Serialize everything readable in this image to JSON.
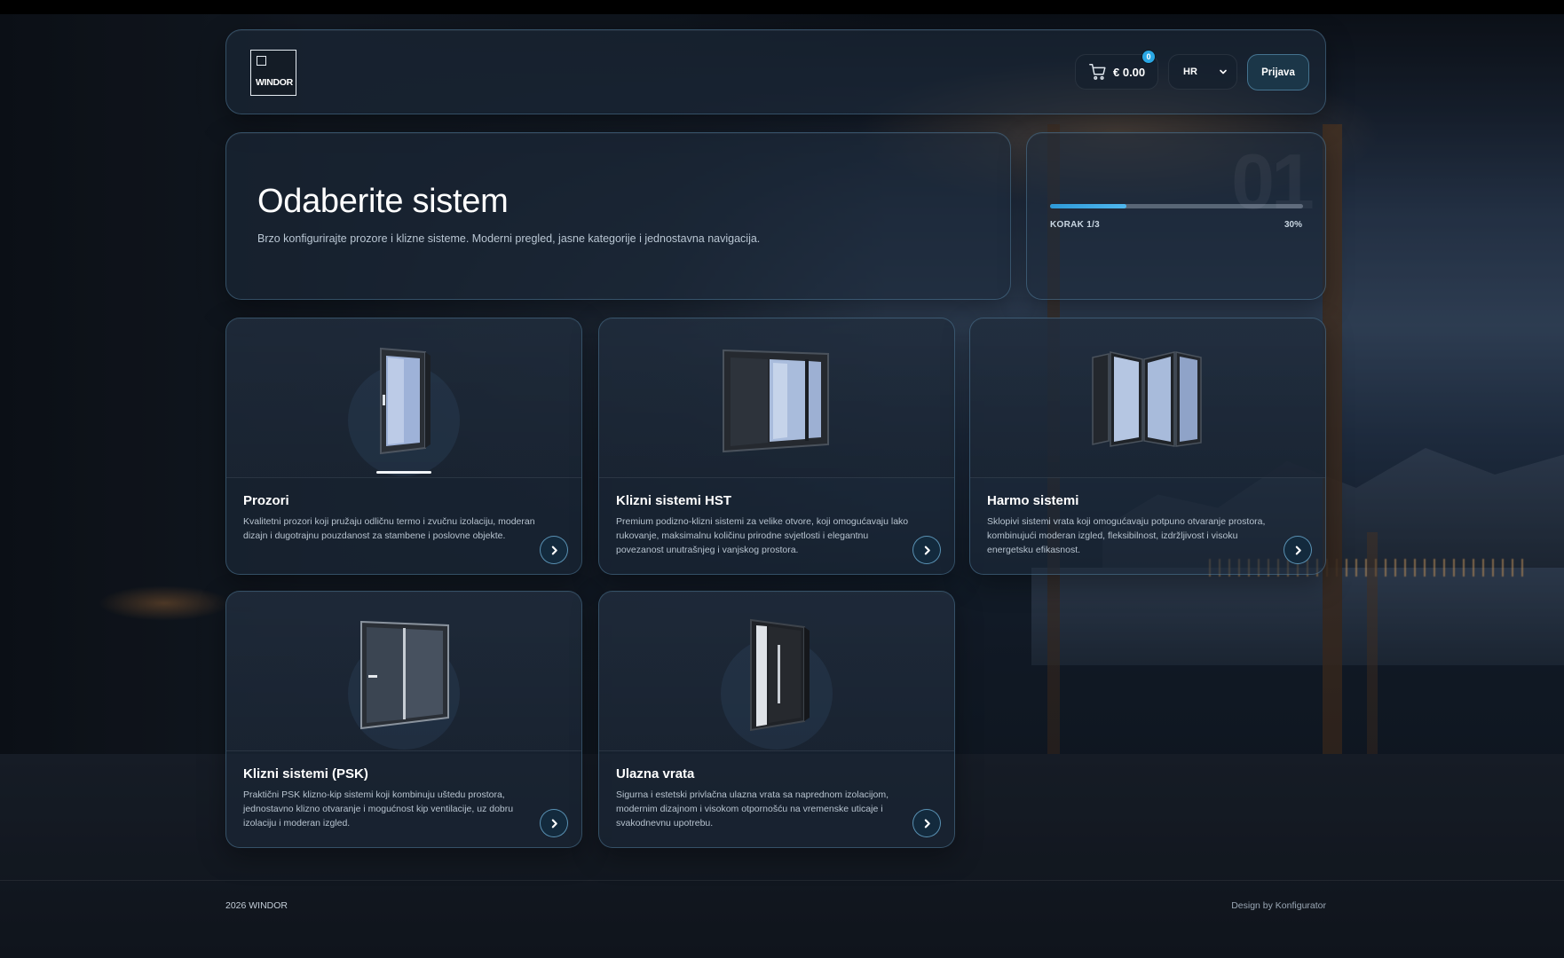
{
  "header": {
    "logo_text": "WINDOR",
    "cart": {
      "price": "€ 0.00",
      "count": "0"
    },
    "language": "HR",
    "login_label": "Prijava"
  },
  "hero": {
    "title": "Odaberite sistem",
    "subtitle": "Brzo konfigurirajte prozore i klizne sisteme. Moderni pregled, jasne kategorije i jednostavna navigacija."
  },
  "progress": {
    "big_number": "01",
    "step_label": "KORAK 1/3",
    "percent_label": "30%",
    "fraction": 0.3,
    "accent": "#2e9ad8"
  },
  "cards": [
    {
      "title": "Prozori",
      "description": "Kvalitetni prozori koji pružaju odličnu termo i zvučnu izolaciju, moderan dizajn i dugotrajnu pouzdanost za stambene i poslovne objekte.",
      "icon": "window-icon",
      "selected": true
    },
    {
      "title": "Klizni sistemi HST",
      "description": "Premium podizno-klizni sistemi za velike otvore, koji omogućavaju lako rukovanje, maksimalnu količinu prirodne svjetlosti i elegantnu povezanost unutrašnjeg i vanjskog prostora.",
      "icon": "sliding-door-icon",
      "selected": false
    },
    {
      "title": "Harmo sistemi",
      "description": "Sklopivi sistemi vrata koji omogućavaju potpuno otvaranje prostora, kombinujući moderan izgled, fleksibilnost, izdržljivost i visoku energetsku efikasnost.",
      "icon": "folding-door-icon",
      "selected": false
    },
    {
      "title": "Klizni sistemi (PSK)",
      "description": "Praktični PSK klizno-kip sistemi koji kombinuju uštedu prostora, jednostavno klizno otvaranje i mogućnost kip ventilacije, uz dobru izolaciju i moderan izgled.",
      "icon": "psk-window-icon",
      "selected": false
    },
    {
      "title": "Ulazna vrata",
      "description": "Sigurna i estetski privlačna ulazna vrata sa naprednom izolacijom, modernim dizajnom i visokom otpornošću na vremenske uticaje i svakodnevnu upotrebu.",
      "icon": "entrance-door-icon",
      "selected": false
    }
  ],
  "footer": {
    "left": "2026 WINDOR",
    "right": "Design by Konfigurator"
  }
}
